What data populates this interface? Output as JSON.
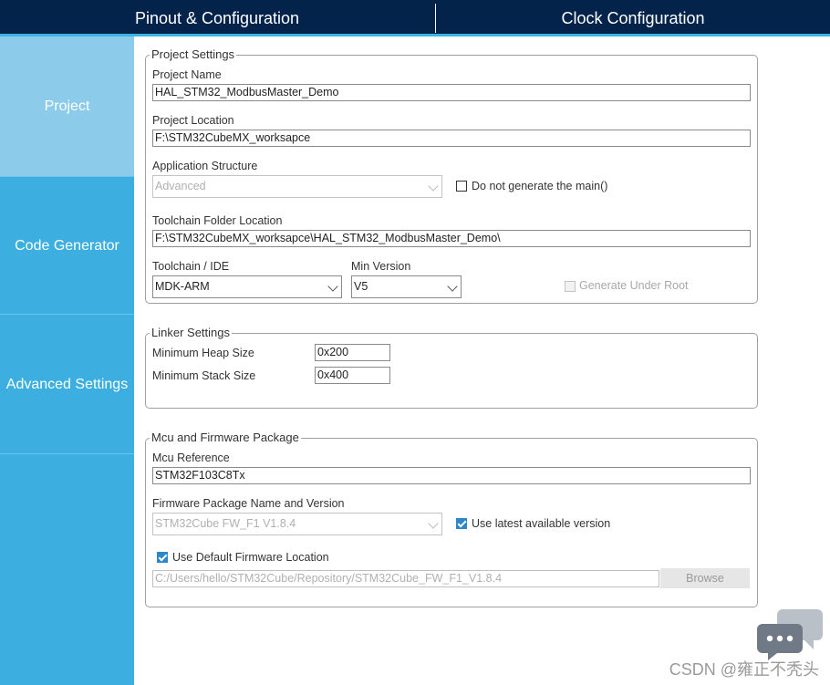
{
  "tabs": [
    {
      "label": "Pinout & Configuration"
    },
    {
      "label": "Clock Configuration"
    }
  ],
  "sidebar": {
    "items": [
      {
        "label": "Project"
      },
      {
        "label": "Code Generator"
      },
      {
        "label": "Advanced Settings"
      }
    ]
  },
  "project_settings": {
    "legend": "Project Settings",
    "project_name_label": "Project Name",
    "project_name_value": "HAL_STM32_ModbusMaster_Demo",
    "project_location_label": "Project Location",
    "project_location_value": "F:\\STM32CubeMX_worksapce",
    "app_structure_label": "Application Structure",
    "app_structure_value": "Advanced",
    "no_main_label": "Do not generate the main()",
    "no_main_checked": false,
    "toolchain_folder_label": "Toolchain Folder Location",
    "toolchain_folder_value": "F:\\STM32CubeMX_worksapce\\HAL_STM32_ModbusMaster_Demo\\",
    "toolchain_ide_label": "Toolchain / IDE",
    "toolchain_ide_value": "MDK-ARM",
    "min_version_label": "Min Version",
    "min_version_value": "V5",
    "generate_under_root_label": "Generate Under Root",
    "generate_under_root_checked": false
  },
  "linker_settings": {
    "legend": "Linker Settings",
    "heap_label": "Minimum Heap Size",
    "heap_value": "0x200",
    "stack_label": "Minimum Stack Size",
    "stack_value": "0x400"
  },
  "mcu_firmware": {
    "legend": "Mcu and Firmware Package",
    "mcu_ref_label": "Mcu Reference",
    "mcu_ref_value": "STM32F103C8Tx",
    "fw_pkg_label": "Firmware Package Name and Version",
    "fw_pkg_value": "STM32Cube FW_F1 V1.8.4",
    "use_latest_label": "Use latest available version",
    "use_latest_checked": true,
    "use_default_fw_label": "Use Default Firmware Location",
    "use_default_fw_checked": true,
    "fw_location_value": "C:/Users/hello/STM32Cube/Repository/STM32Cube_FW_F1_V1.8.4",
    "browse_label": "Browse"
  },
  "watermark": "CSDN @雍正不秃头",
  "colors": {
    "topbar": "#03234b",
    "accent": "#3cb4e6",
    "sidebar": "#3caee0",
    "sidebar_active": "#8ccbe9",
    "checkbox": "#2e87c8"
  }
}
